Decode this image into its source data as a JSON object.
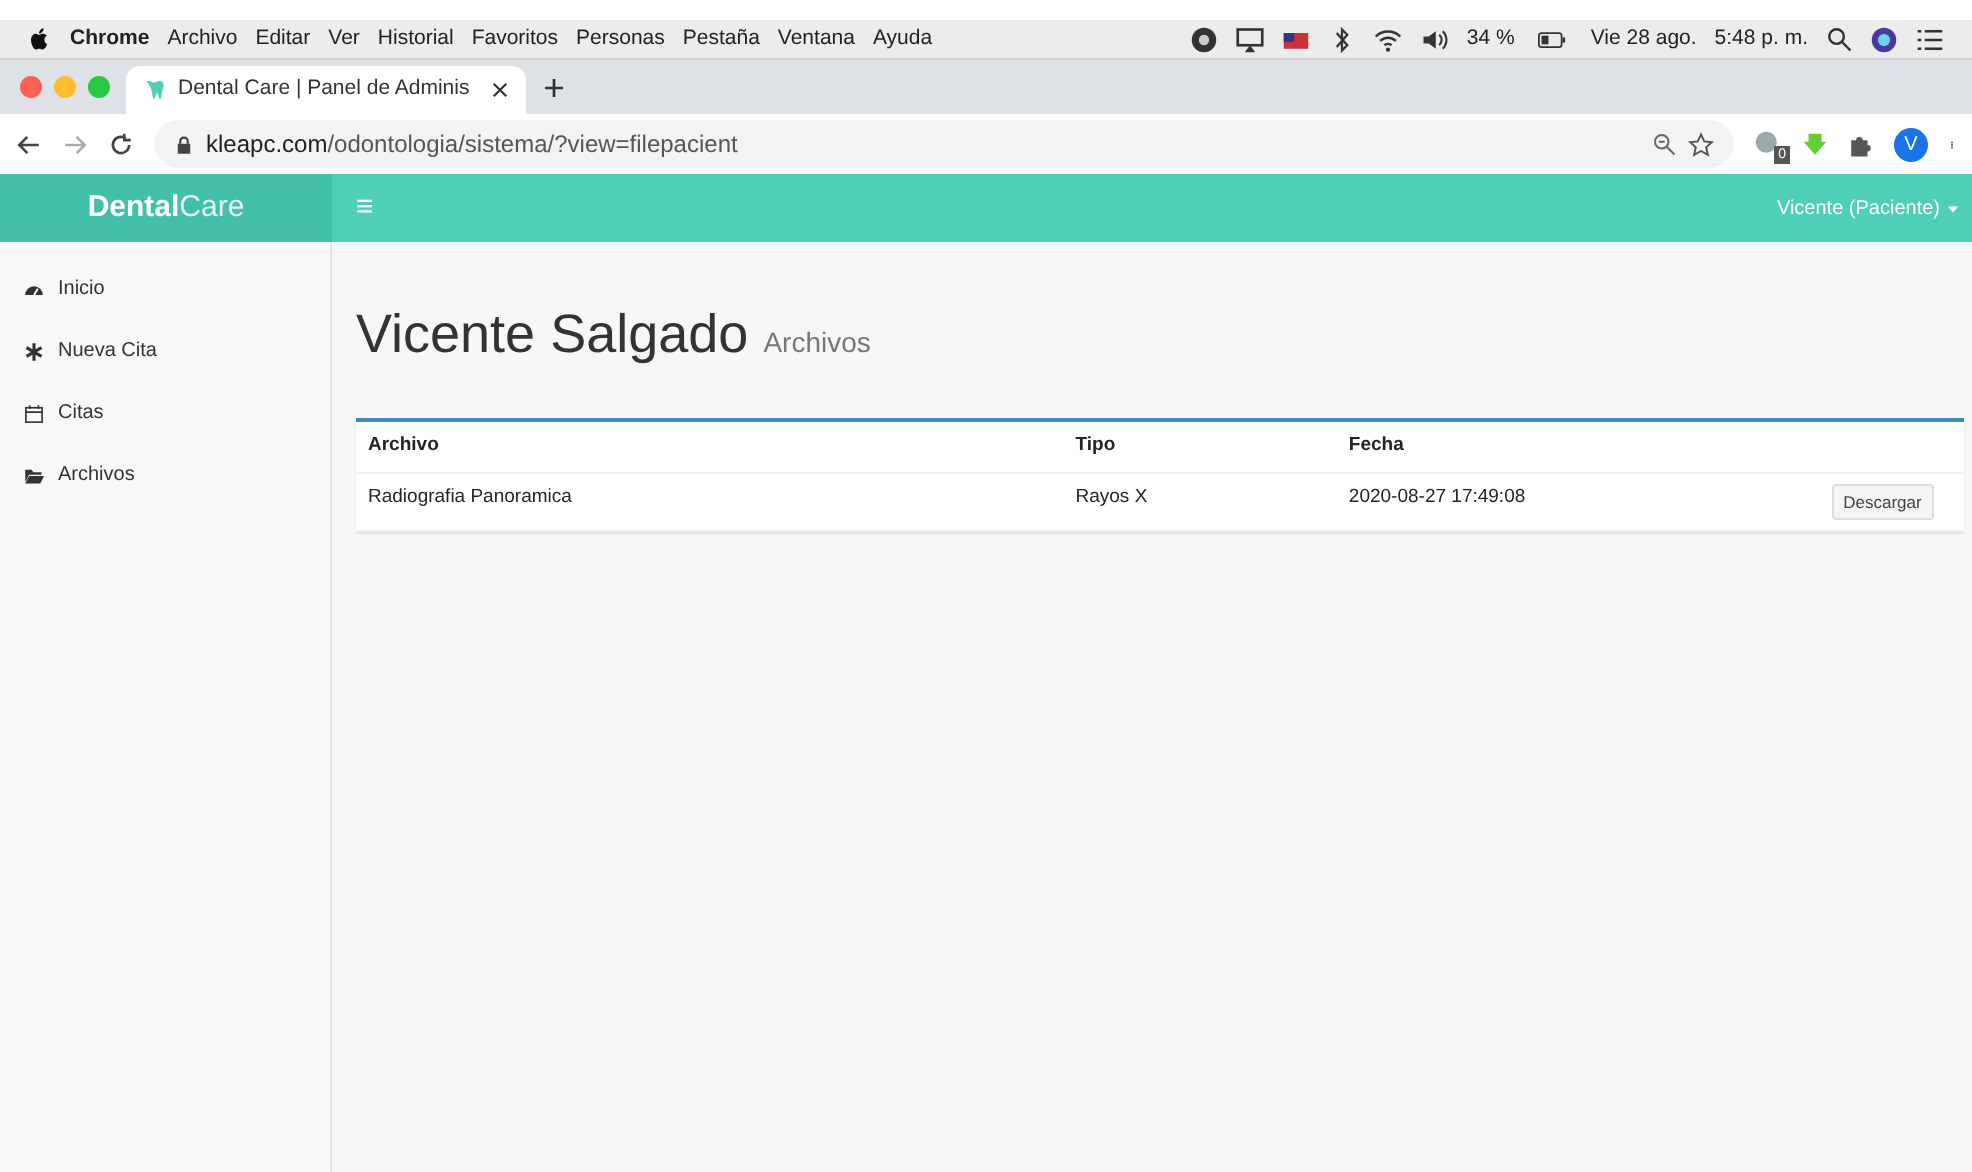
{
  "menu_bar": {
    "app_name": "Chrome",
    "menus": [
      "Archivo",
      "Editar",
      "Ver",
      "Historial",
      "Favoritos",
      "Personas",
      "Pestaña",
      "Ventana",
      "Ayuda"
    ],
    "battery": "34 %",
    "date": "Vie 28 ago.",
    "time": "5:48 p. m."
  },
  "browser": {
    "tab_title": "Dental Care | Panel de Adminis",
    "url_host": "kleapc.com",
    "url_path": "/odontologia/sistema/?view=filepacient",
    "extension_badge": "0",
    "profile_initial": "V"
  },
  "navbar": {
    "brand_bold": "Dental",
    "brand_light": "Care",
    "menu_toggle": "≡",
    "user_menu": "Vicente (Paciente)"
  },
  "sidebar": {
    "items": [
      {
        "label": "Inicio"
      },
      {
        "label": "Nueva Cita"
      },
      {
        "label": "Citas"
      },
      {
        "label": "Archivos"
      }
    ]
  },
  "page": {
    "title": "Vicente Salgado",
    "subtitle": "Archivos"
  },
  "table": {
    "columns": [
      "Archivo",
      "Tipo",
      "Fecha"
    ],
    "rows": [
      {
        "cells": [
          "Radiografia Panoramica",
          "Rayos X",
          "2020-08-27 17:49:08"
        ],
        "action": "Descargar"
      }
    ]
  }
}
